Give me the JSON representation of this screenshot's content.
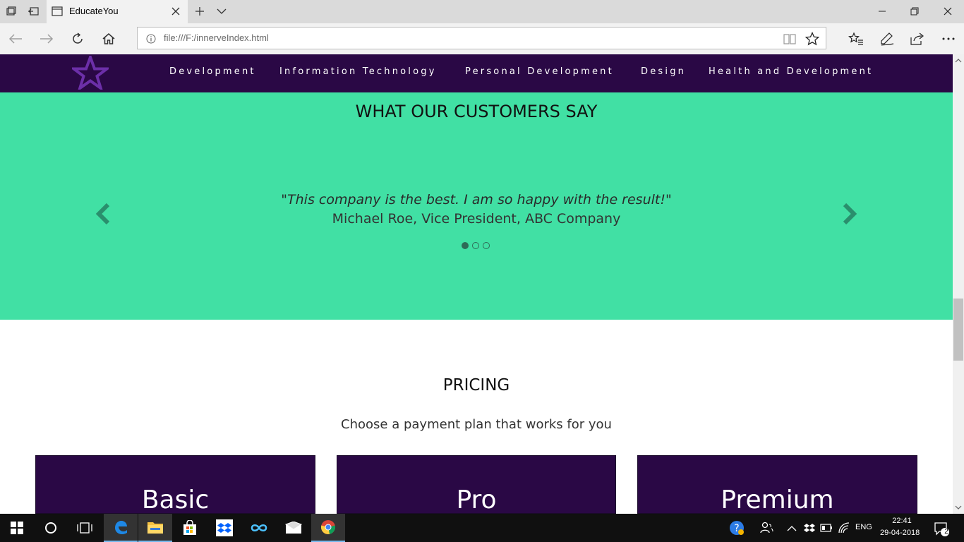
{
  "browser": {
    "tab_title": "EducateYou",
    "url": "file:///F:/innerveIndex.html"
  },
  "nav": {
    "links": [
      "Development",
      "Information Technology",
      "Personal Development",
      "Design",
      "Health and Development"
    ]
  },
  "testimonials": {
    "title": "WHAT OUR CUSTOMERS SAY",
    "quote": "\"This company is the best. I am so happy with the result!\"",
    "author": "Michael Roe, Vice President, ABC Company",
    "active_index": 0,
    "slide_count": 3
  },
  "pricing": {
    "title": "PRICING",
    "subtitle": "Choose a payment plan that works for you",
    "plans": [
      "Basic",
      "Pro",
      "Premium"
    ]
  },
  "taskbar": {
    "lang": "ENG",
    "time": "22:41",
    "date": "29-04-2018",
    "notifications": "2"
  },
  "colors": {
    "nav_bg": "#2a0845",
    "testimonial_bg": "#41e0a4",
    "logo_star": "#6c2fa8"
  }
}
